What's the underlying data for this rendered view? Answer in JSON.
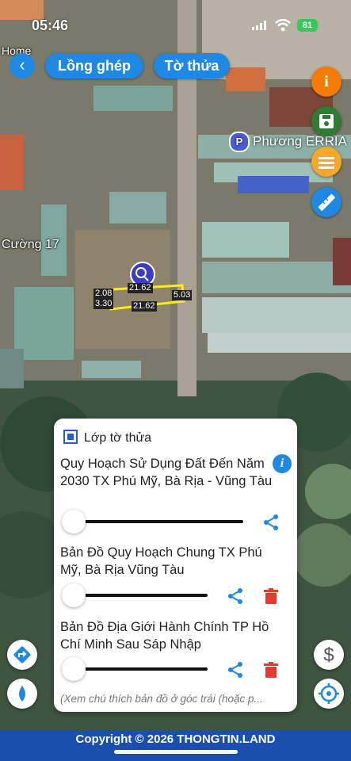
{
  "status_bar": {
    "time": "05:46",
    "battery": "81"
  },
  "header": {
    "back_icon": "chevron-left-icon",
    "tab_overlay": "Lồng ghép",
    "tab_parcel": "Tờ thửa"
  },
  "right_tools": [
    {
      "name": "info-icon",
      "color": "#f57c00"
    },
    {
      "name": "save-icon",
      "color": "#2e7d32"
    },
    {
      "name": "list-icon",
      "color": "#f9a825"
    },
    {
      "name": "ruler-icon",
      "color": "#1e88e5"
    }
  ],
  "map": {
    "poi_label": "Phương ERRIA",
    "poi_letter": "P",
    "labels": {
      "home": "Home",
      "cuong": "Cường 17"
    },
    "parcel": {
      "dims": {
        "left_top": "2.08",
        "left_bottom": "3.30",
        "top": "21.62",
        "bottom": "21.62",
        "right": "5.03"
      }
    }
  },
  "layer_panel": {
    "title": "Lớp tờ thửa",
    "layers": [
      {
        "name": "Quy Hoạch Sử Dụng Đất Đến Năm 2030 TX Phú Mỹ, Bà Rịa - Vũng Tàu",
        "opacity": 0
      },
      {
        "name": "Bản Đồ Quy Hoạch Chung TX Phú Mỹ, Bà Rịa Vũng Tàu",
        "opacity": 0
      },
      {
        "name": "Bản Đồ Địa Giới Hành Chính TP Hồ Chí Minh Sau Sáp Nhập",
        "opacity": 0
      }
    ],
    "note": "(Xem chú thích bản đồ ở góc trái (hoặc p..."
  },
  "left_tools": [
    "directions-icon",
    "water-drop-icon"
  ],
  "bottom_right_tools": [
    "dollar-icon",
    "locate-icon"
  ],
  "footer": {
    "copyright": "Copyright © 2026 THONGTIN.LAND"
  },
  "colors": {
    "accent": "#1e88e5",
    "footer": "#1a4fb0",
    "parcel_outline": "#ffee00",
    "delete": "#e53935"
  }
}
